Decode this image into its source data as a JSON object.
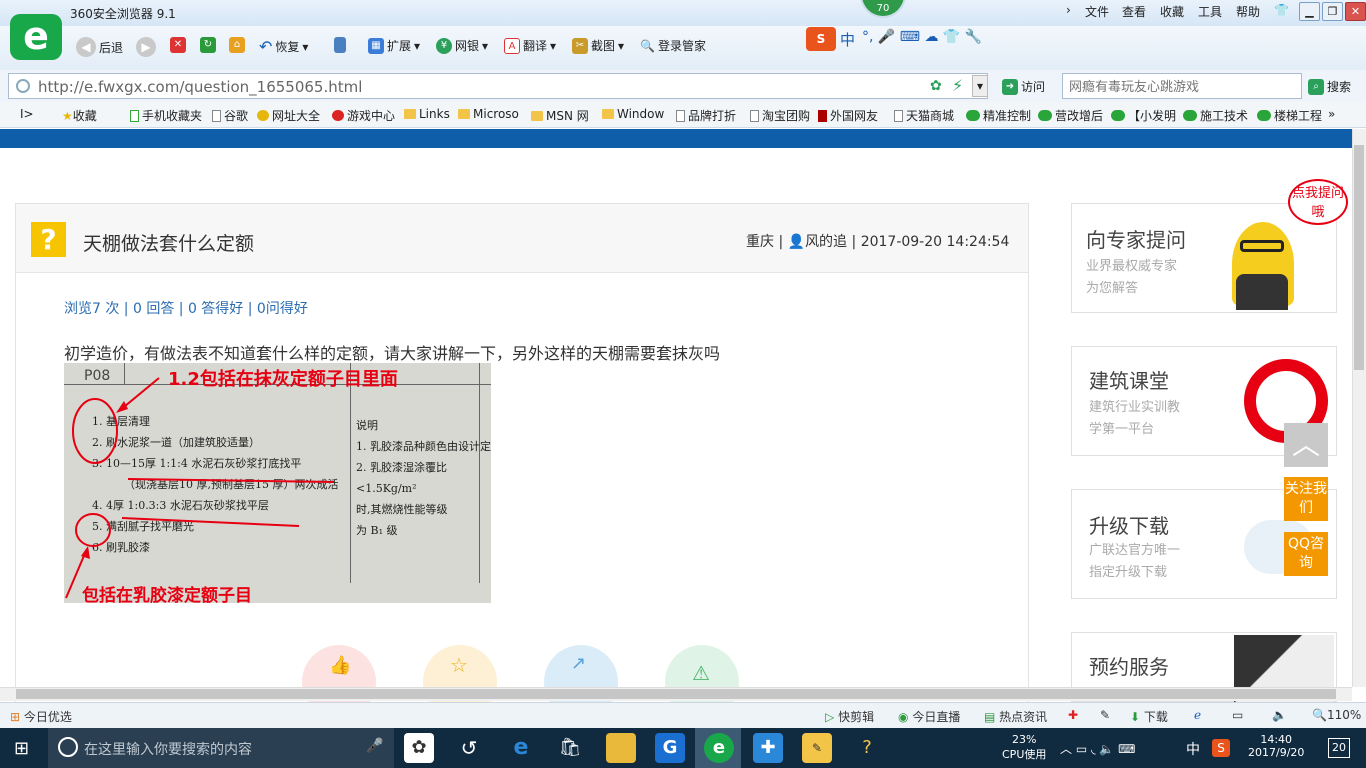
{
  "browser": {
    "title": "360安全浏览器 9.1",
    "badge": "70",
    "menu": [
      "文件",
      "查看",
      "收藏",
      "工具",
      "帮助"
    ],
    "toolbar": {
      "back": "后退",
      "restore": "恢复",
      "extend": "扩展",
      "netbank": "网银",
      "translate": "翻译",
      "screenshot": "截图",
      "login": "登录管家"
    },
    "ime": "中",
    "url": "http://e.fwxgx.com/question_1655065.html",
    "visit": "访问",
    "search_placeholder": "网瘾有毒玩友心跳游戏",
    "search_btn": "搜索",
    "favorites": [
      "收藏",
      "手机收藏夹",
      "谷歌",
      "网址大全",
      "游戏中心",
      "Links",
      "Microso",
      "MSN 网",
      "Window",
      "品牌打折",
      "淘宝团购",
      "外国网友",
      "天猫商城",
      "精准控制",
      "营改增后",
      "【小发明",
      "施工技术",
      "楼梯工程"
    ]
  },
  "question": {
    "title": "天棚做法套什么定额",
    "location": "重庆",
    "author": "风的追",
    "datetime": "2017-09-20 14:24:54",
    "stats": "浏览7 次 | 0 回答 | 0 答得好 | 0问得好",
    "text": "初学造价，有做法表不知道套什么样的定额，请大家讲解一下，另外这样的天棚需要套抹灰吗",
    "annotation1": "1.2包括在抹灰定额子目里面",
    "annotation2": "包括在乳胶漆定额子目",
    "photo_code": "P08",
    "photo_items": [
      "1.  基层清理",
      "2.  刷水泥浆一道（加建筑胶适量）",
      "3.  10—15厚 1:1:4 水泥石灰砂浆打底找平",
      "（现浇基层10 厚,预制基层15 厚）两次成活",
      "4.  4厚 1:0.3:3 水泥石灰砂浆找平层",
      "5.  满刮腻子找平磨光",
      "6.  刷乳胶漆"
    ],
    "photo_notes": [
      "说明",
      "1. 乳胶漆品种颜色由设计定",
      "2. 乳胶漆湿涂覆比",
      "<1.5Kg/m²",
      "时,其燃烧性能等级",
      "为 B₁ 级"
    ]
  },
  "sidebar": {
    "bubble": "点我提问哦",
    "cards": [
      {
        "title": "向专家提问",
        "sub1": "业界最权威专家",
        "sub2": "为您解答"
      },
      {
        "title": "建筑课堂",
        "sub1": "建筑行业实训教",
        "sub2": "学第一平台"
      },
      {
        "title": "升级下载",
        "sub1": "广联达官方唯一",
        "sub2": "指定升级下载"
      },
      {
        "title": "预约服务",
        "sub1": "",
        "sub2": ""
      }
    ],
    "follow": "关注我们",
    "qq": "QQ咨询"
  },
  "statusbar": {
    "left": "今日优选",
    "kuaijian": "快剪辑",
    "live": "今日直播",
    "news": "热点资讯",
    "download": "下载",
    "zoom": "110%"
  },
  "taskbar": {
    "search": "在这里输入你要搜索的内容",
    "cpu_pct": "23%",
    "cpu_label": "CPU使用",
    "ime": "中",
    "time": "14:40",
    "date": "2017/9/20",
    "notif": "20"
  },
  "colors": {
    "accent": "#0e5ea9",
    "orange": "#f39800",
    "red": "#e60012"
  }
}
